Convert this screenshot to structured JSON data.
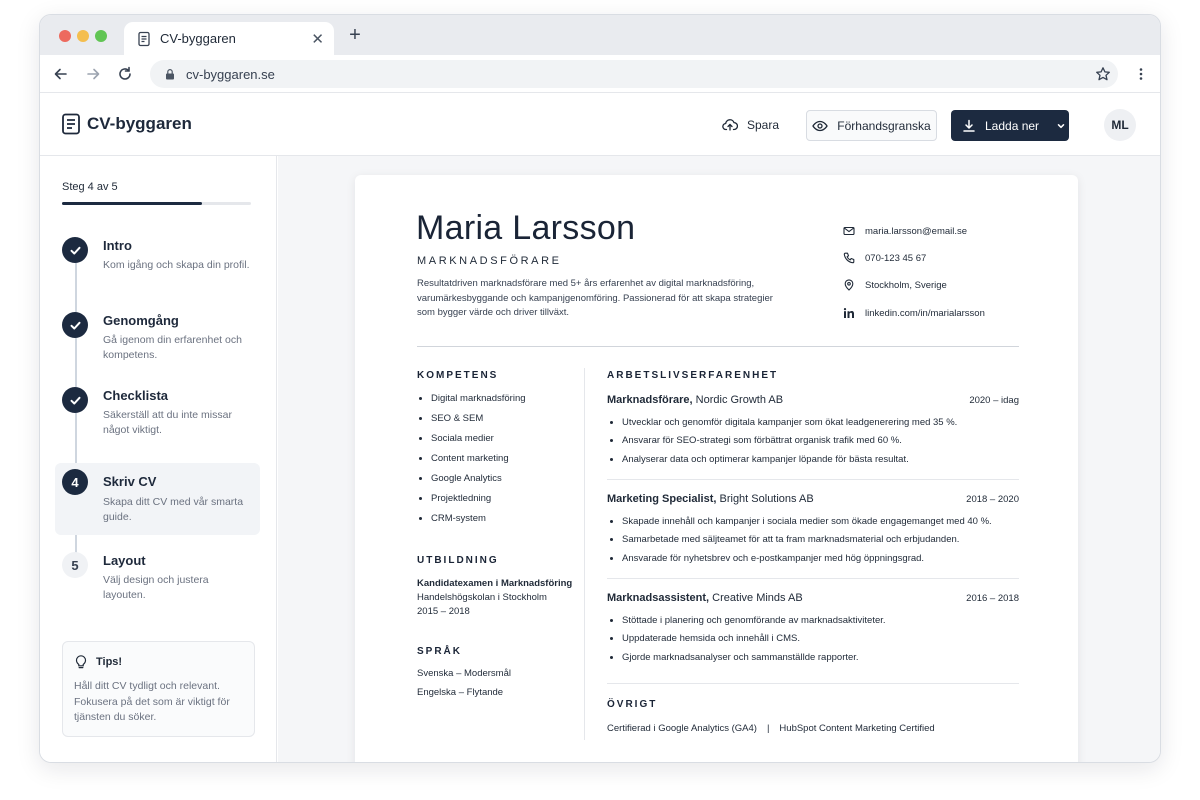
{
  "browser": {
    "tab_title": "CV-byggaren",
    "new_tab": "+",
    "url": "cv-byggaren.se"
  },
  "header": {
    "app_name": "CV-byggaren",
    "save_label": "Spara",
    "preview_label": "Förhandsgranska",
    "download_label": "Ladda ner",
    "avatar_initials": "ML"
  },
  "sidebar": {
    "step_counter": "Steg 4 av 5",
    "progress": 0.74,
    "steps": [
      {
        "number": "1",
        "title": "Intro",
        "description": "Kom igång och skapa din profil.",
        "status": "done"
      },
      {
        "number": "2",
        "title": "Genomgång",
        "description": "Gå igenom din erfarenhet och kompetens.",
        "status": "done"
      },
      {
        "number": "3",
        "title": "Checklista",
        "description": "Säkerställ att du inte missar något viktigt.",
        "status": "done"
      },
      {
        "number": "4",
        "title": "Skriv CV",
        "description": "Skapa ditt CV med vår smarta guide.",
        "status": "current"
      },
      {
        "number": "5",
        "title": "Layout",
        "description": "Välj design och justera layouten.",
        "status": "todo"
      }
    ],
    "tips": {
      "title": "Tips!",
      "text": "Håll ditt CV tydligt och relevant. Fokusera på det som är viktigt för tjänsten du söker."
    }
  },
  "cv": {
    "name": "Maria Larsson",
    "role": "MARKNADSFÖRARE",
    "summary": "Resultatdriven marknadsförare med 5+ års erfarenhet av digital marknadsföring, varumärkesbyggande och kampanjgenomföring. Passionerad för att skapa strategier som bygger värde och driver tillväxt.",
    "contact": {
      "email": "maria.larsson@email.se",
      "phone": "070-123 45 67",
      "location": "Stockholm, Sverige",
      "linkedin": "linkedin.com/in/marialarsson"
    },
    "competence_title": "KOMPETENS",
    "skills": [
      "Digital marknadsföring",
      "SEO & SEM",
      "Sociala medier",
      "Content marketing",
      "Google Analytics",
      "Projektledning",
      "CRM-system"
    ],
    "education_title": "UTBILDNING",
    "education": {
      "degree": "Kandidatexamen i Marknadsföring",
      "school": "Handelshögskolan i Stockholm",
      "years": "2015 – 2018"
    },
    "languages_title": "SPRÅK",
    "languages": [
      "Svenska – Modersmål",
      "Engelska – Flytande"
    ],
    "experience_title": "ARBETSLIVSERFARENHET",
    "jobs": [
      {
        "title": "Marknadsförare,",
        "company": "Nordic Growth AB",
        "dates": "2020 – idag",
        "bullets": [
          "Utvecklar och genomför digitala kampanjer som ökat leadgenerering med 35 %.",
          "Ansvarar för SEO-strategi som förbättrat organisk trafik med 60 %.",
          "Analyserar data och optimerar kampanjer löpande för bästa resultat."
        ]
      },
      {
        "title": "Marketing Specialist,",
        "company": "Bright Solutions AB",
        "dates": "2018 – 2020",
        "bullets": [
          "Skapade innehåll och kampanjer i sociala medier som ökade engagemanget med 40 %.",
          "Samarbetade med säljteamet för att ta fram marknadsmaterial och erbjudanden.",
          "Ansvarade för nyhetsbrev och e-postkampanjer med hög öppningsgrad."
        ]
      },
      {
        "title": "Marknadsassistent,",
        "company": "Creative Minds AB",
        "dates": "2016 – 2018",
        "bullets": [
          "Stöttade i planering och genomförande av marknadsaktiviteter.",
          "Uppdaterade hemsida och innehåll i CMS.",
          "Gjorde marknadsanalyser och sammanställde rapporter."
        ]
      }
    ],
    "other_title": "ÖVRIGT",
    "certifications": [
      "Certifierad i Google Analytics (GA4)",
      "|",
      "HubSpot Content Marketing Certified"
    ]
  },
  "colors": {
    "primary": "#1c2a40",
    "background": "#f5f6f8",
    "border": "#e5e7eb"
  }
}
